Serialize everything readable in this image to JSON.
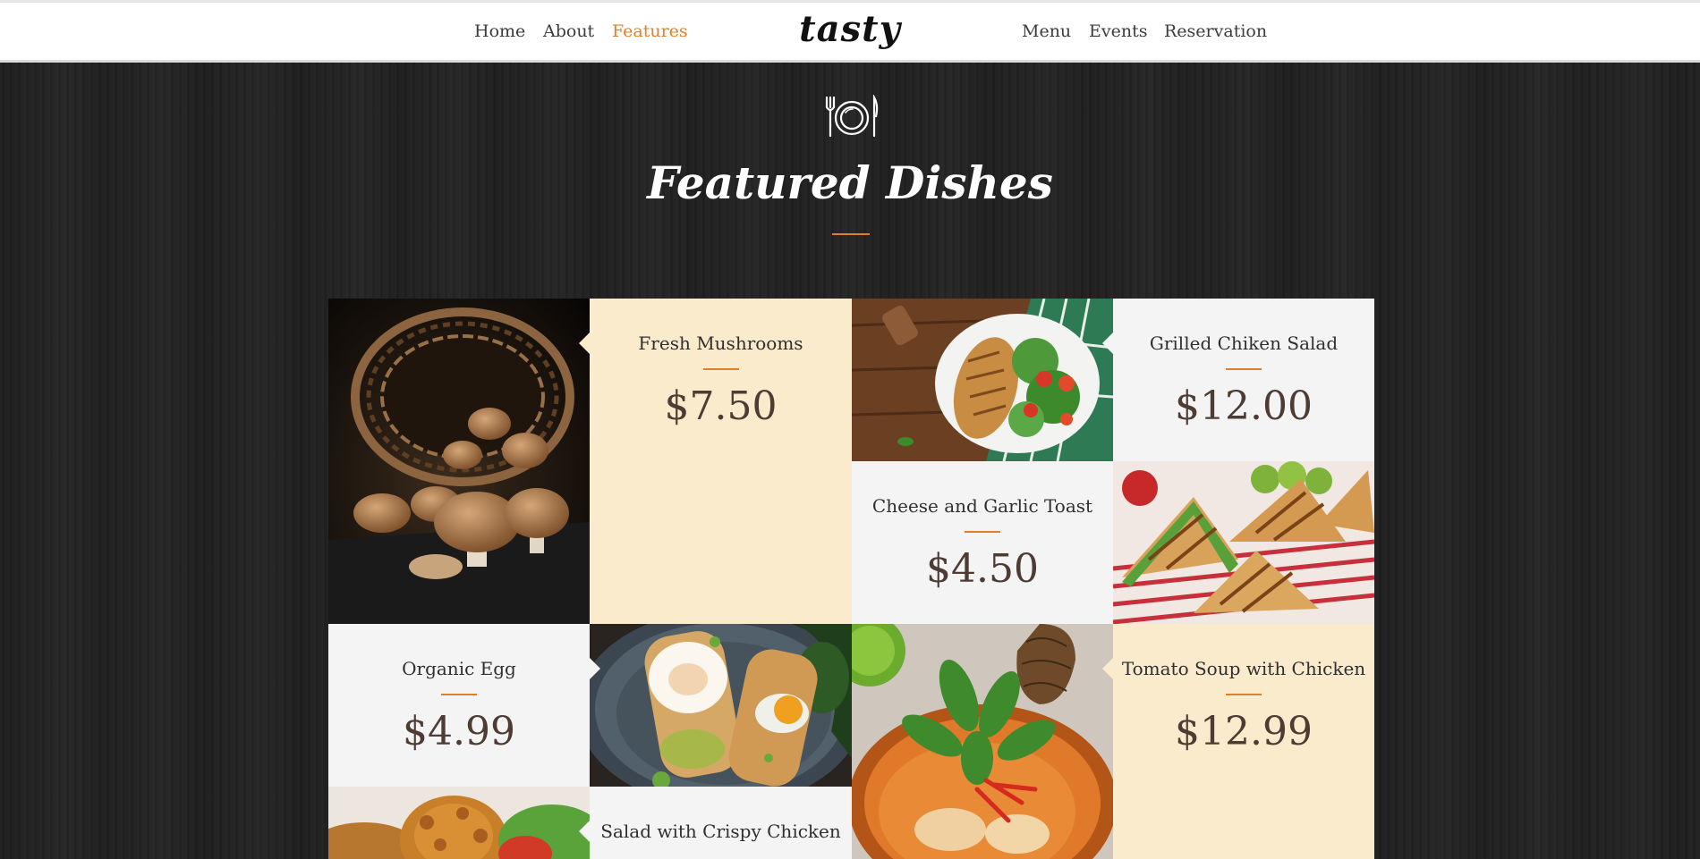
{
  "nav": {
    "left_links": [
      {
        "label": "Home",
        "active": false
      },
      {
        "label": "About",
        "active": false
      },
      {
        "label": "Features",
        "active": true
      }
    ],
    "logo": "tasty",
    "right_links": [
      {
        "label": "Menu",
        "active": false
      },
      {
        "label": "Events",
        "active": false
      },
      {
        "label": "Reservation",
        "active": false
      }
    ]
  },
  "section": {
    "icon": "plate-cutlery-icon",
    "title": "Featured Dishes"
  },
  "colors": {
    "accent": "#e07f28",
    "cream_tile": "#f9ebcc",
    "grey_tile": "#f4f4f4",
    "background": "#232323"
  },
  "dishes": [
    {
      "name": "Fresh Mushrooms",
      "price": "$7.50",
      "photo": "mushrooms-photo"
    },
    {
      "name": "Grilled Chiken Salad",
      "price": "$12.00",
      "photo": "grilled-chicken-salad-photo"
    },
    {
      "name": "Cheese and Garlic Toast",
      "price": "$4.50",
      "photo": "toast-sandwich-photo"
    },
    {
      "name": "Organic Egg",
      "price": "$4.99",
      "photo": "poached-egg-toast-photo"
    },
    {
      "name": "Tomato Soup with Chicken",
      "price": "$12.99",
      "photo": "tomato-soup-photo"
    },
    {
      "name": "Salad with Crispy Chicken",
      "price": "",
      "photo": "crispy-chicken-photo"
    }
  ]
}
